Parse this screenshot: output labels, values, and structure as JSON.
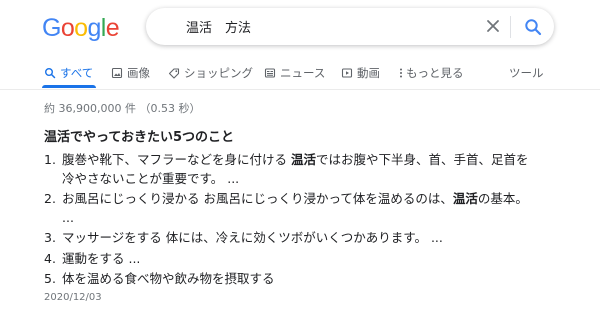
{
  "logo": {
    "letters": [
      "G",
      "o",
      "o",
      "g",
      "l",
      "e"
    ],
    "colors": [
      "#4285F4",
      "#EA4335",
      "#FBBC05",
      "#4285F4",
      "#34A853",
      "#EA4335"
    ]
  },
  "search": {
    "query": "温活　方法",
    "clear_icon": "close-icon",
    "search_icon": "search-icon"
  },
  "tabs": [
    {
      "label": "すべて",
      "icon": "search-icon",
      "active": true
    },
    {
      "label": "画像",
      "icon": "image-icon",
      "active": false
    },
    {
      "label": "ショッピング",
      "icon": "tag-icon",
      "active": false
    },
    {
      "label": "ニュース",
      "icon": "news-icon",
      "active": false
    },
    {
      "label": "動画",
      "icon": "video-icon",
      "active": false
    },
    {
      "label": "もっと見る",
      "icon": "more-vert-icon",
      "active": false
    },
    {
      "label": "ツール",
      "icon": "",
      "active": false
    }
  ],
  "stats": "約 36,900,000 件 （0.53 秒）",
  "snippet": {
    "title": "温活でやっておきたい5つのこと",
    "items": [
      {
        "num": "1.",
        "line1_pre": "腹巻や靴下、マフラーなどを身に付ける ",
        "line1_bold": "温活",
        "line1_post": "ではお腹や下半身、首、手首、足首を",
        "line2": "冷やさないことが重要です。 ..."
      },
      {
        "num": "2.",
        "line1_pre": "お風呂にじっくり浸かる お風呂にじっくり浸かって体を温めるのは、",
        "line1_bold": "温活",
        "line1_post": "の基本。",
        "line2": "..."
      },
      {
        "num": "3.",
        "line1_pre": "マッサージをする 体には、冷えに効くツボがいくつかあります。 ...",
        "line1_bold": "",
        "line1_post": "",
        "line2": ""
      },
      {
        "num": "4.",
        "line1_pre": "運動をする ...",
        "line1_bold": "",
        "line1_post": "",
        "line2": ""
      },
      {
        "num": "5.",
        "line1_pre": "体を温める食べ物や飲み物を摂取する",
        "line1_bold": "",
        "line1_post": "",
        "line2": ""
      }
    ],
    "date": "2020/12/03"
  }
}
